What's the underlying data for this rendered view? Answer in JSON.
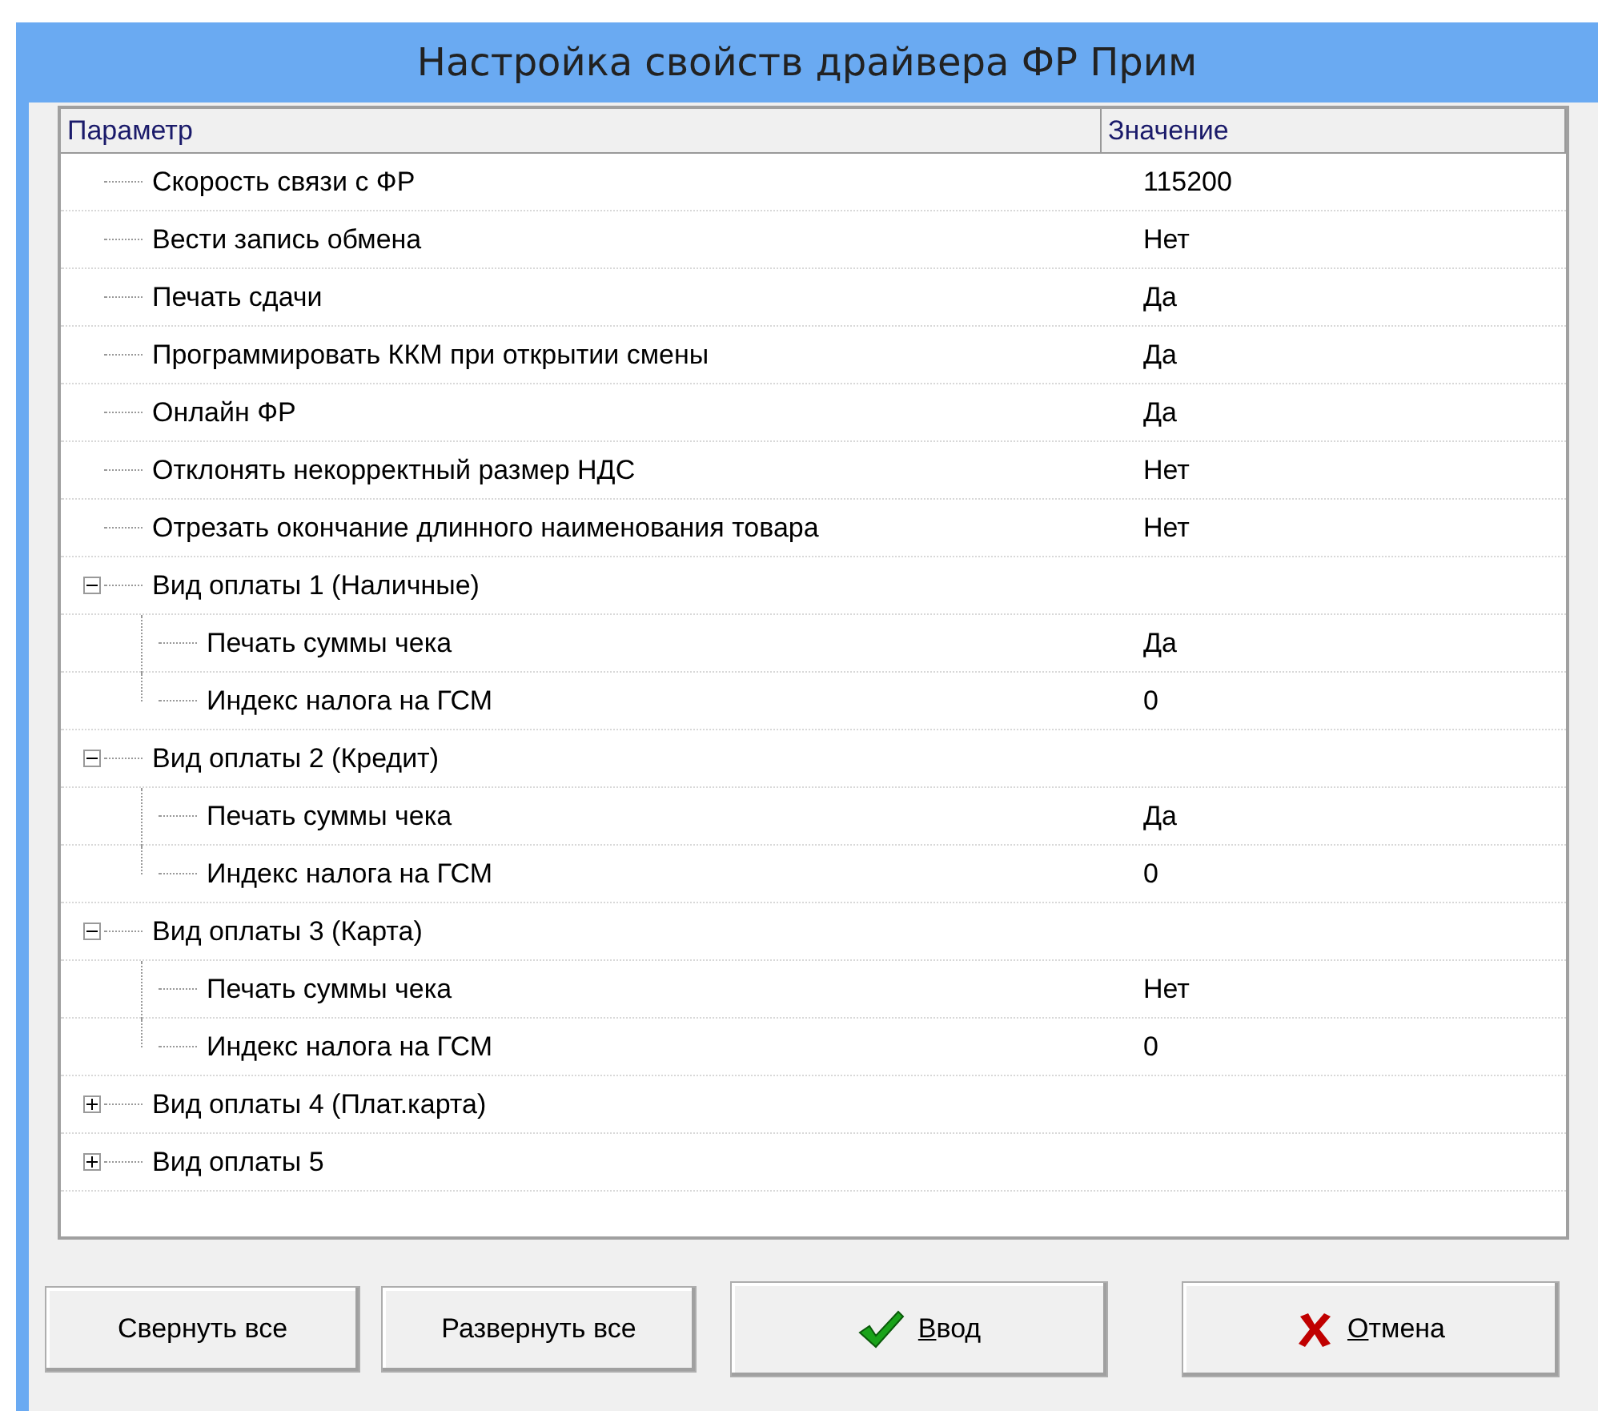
{
  "window": {
    "title": "Настройка свойств драйвера ФР Прим"
  },
  "table": {
    "columns": [
      "Параметр",
      "Значение"
    ],
    "rows": [
      {
        "name": "Скорость связи с ФР",
        "value": "115200"
      },
      {
        "name": "Вести запись обмена",
        "value": "Нет"
      },
      {
        "name": "Печать сдачи",
        "value": "Да"
      },
      {
        "name": "Программировать ККМ при открытии смены",
        "value": "Да"
      },
      {
        "name": "Онлайн ФР",
        "value": "Да"
      },
      {
        "name": "Отклонять некорректный размер НДС",
        "value": "Нет"
      },
      {
        "name": "Отрезать окончание длинного наименования товара",
        "value": "Нет"
      },
      {
        "name": "Вид оплаты 1 (Наличные)",
        "expanded": true,
        "children": [
          {
            "name": "Печать суммы чека",
            "value": "Да"
          },
          {
            "name": "Индекс налога на ГСМ",
            "value": "0"
          }
        ]
      },
      {
        "name": "Вид оплаты 2 (Кредит)",
        "expanded": true,
        "children": [
          {
            "name": "Печать суммы чека",
            "value": "Да"
          },
          {
            "name": "Индекс налога на ГСМ",
            "value": "0"
          }
        ]
      },
      {
        "name": "Вид оплаты 3 (Карта)",
        "expanded": true,
        "children": [
          {
            "name": "Печать суммы чека",
            "value": "Нет"
          },
          {
            "name": "Индекс налога на ГСМ",
            "value": "0"
          }
        ]
      },
      {
        "name": "Вид оплаты 4 (Плат.карта)",
        "expanded": false
      },
      {
        "name": "Вид оплаты 5",
        "expanded": false
      }
    ]
  },
  "buttons": [
    {
      "label": "Свернуть все",
      "kind": "plain"
    },
    {
      "label": "Развернуть все",
      "kind": "plain"
    },
    {
      "label": "Ввод",
      "kind": "ok"
    },
    {
      "label": "Отмена",
      "kind": "cancel"
    }
  ]
}
